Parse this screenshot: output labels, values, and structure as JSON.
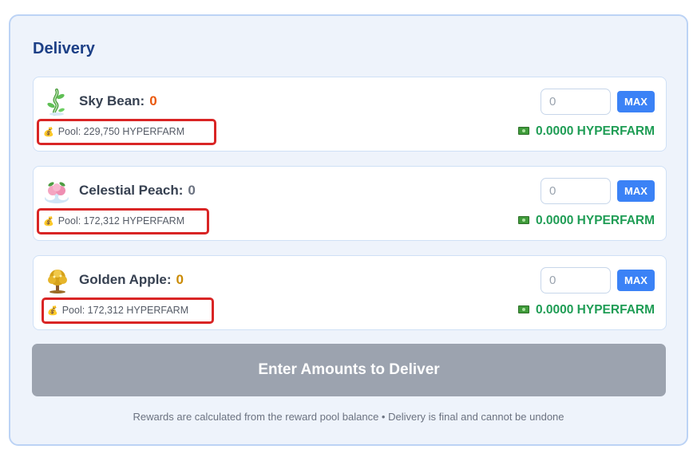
{
  "panel": {
    "title": "Delivery",
    "items": [
      {
        "name": "Sky Bean:",
        "count": "0",
        "count_color": "#ea580c",
        "icon": "sky-bean-icon",
        "pool": "Pool: 229,750 HYPERFARM",
        "placeholder": "0",
        "max_label": "MAX",
        "reward": "0.0000 HYPERFARM"
      },
      {
        "name": "Celestial Peach:",
        "count": "0",
        "count_color": "#6b7280",
        "icon": "celestial-peach-icon",
        "pool": "Pool: 172,312 HYPERFARM",
        "placeholder": "0",
        "max_label": "MAX",
        "reward": "0.0000 HYPERFARM"
      },
      {
        "name": "Golden Apple:",
        "count": "0",
        "count_color": "#ca8a04",
        "icon": "golden-apple-icon",
        "pool": "Pool: 172,312 HYPERFARM",
        "placeholder": "0",
        "max_label": "MAX",
        "reward": "0.0000 HYPERFARM"
      }
    ],
    "deliver_label": "Enter Amounts to Deliver",
    "footer": "Rewards are calculated from the reward pool balance • Delivery is final and cannot be undone"
  },
  "colors": {
    "title": "#1c3f86",
    "reward": "#1f9d55",
    "max_button": "#3b82f6",
    "deliver_button_disabled": "#9ca3af",
    "highlight_box": "#d92525"
  }
}
